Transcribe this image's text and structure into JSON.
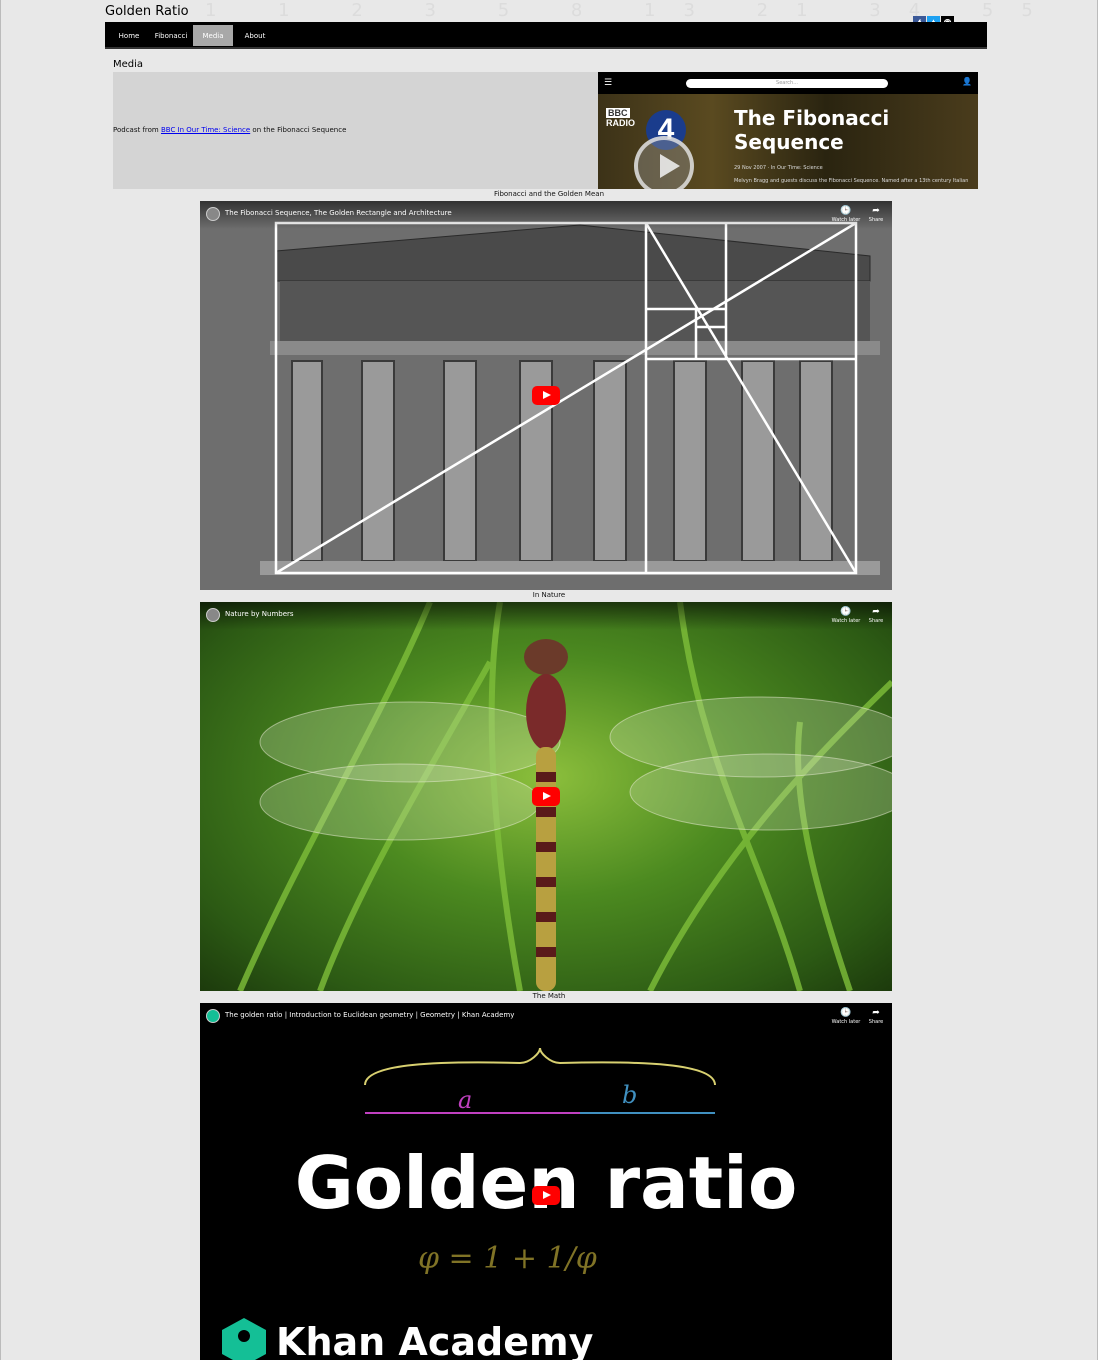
{
  "site": {
    "title": "Golden Ratio",
    "background_digits": "1 1 2 3 5 8 13 21 34 55"
  },
  "social": [
    {
      "icon": "facebook-icon",
      "glyph": "f",
      "color": "#3b5998"
    },
    {
      "icon": "twitter-icon",
      "glyph": "t",
      "color": "#1da1f2"
    },
    {
      "icon": "github-icon",
      "glyph": "◉",
      "color": "#000000"
    }
  ],
  "nav": {
    "items": [
      {
        "label": "Home",
        "active": false
      },
      {
        "label": "Fibonacci",
        "active": false
      },
      {
        "label": "Media",
        "active": true
      },
      {
        "label": "About",
        "active": false
      }
    ]
  },
  "page": {
    "heading": "Media"
  },
  "podcast": {
    "prefix": "Podcast from ",
    "link_text": "BBC In Our Time: Science",
    "suffix": " on the Fibonacci Sequence"
  },
  "bbc_embed": {
    "menu_icon": "☰",
    "search_placeholder": "Search...",
    "user_icon": "👤",
    "logo_line1": "BBC",
    "logo_line2": "RADIO",
    "station": "4",
    "title_line1": "The Fibonacci",
    "title_line2": "Sequence",
    "date": "29 Nov 2007 · In Our Time: Science",
    "description": "Melvyn Bragg and guests discuss the Fibonacci Sequence. Named after a 13th century Italian"
  },
  "videos": [
    {
      "caption": "Fibonacci and the Golden Mean",
      "title": "The Fibonacci Sequence, The Golden Rectangle and Architecture",
      "watch_later": "Watch later",
      "share": "Share"
    },
    {
      "caption": "In Nature",
      "title": "Nature by Numbers",
      "watch_later": "Watch later",
      "share": "Share"
    },
    {
      "caption": "The Math",
      "title": "The golden ratio | Introduction to Euclidean geometry | Geometry | Khan Academy",
      "watch_later": "Watch later",
      "share": "Share",
      "overlay_title": "Golden ratio",
      "brand": "Khan Academy",
      "label_a": "a",
      "label_b": "b",
      "formula": "φ = 1 + 1/φ"
    }
  ]
}
